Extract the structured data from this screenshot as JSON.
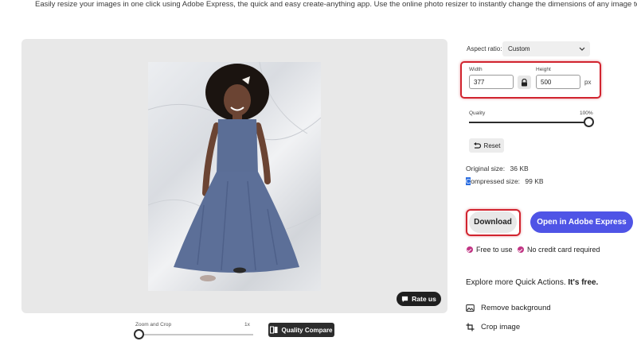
{
  "intro_text": "Easily resize your images in one click using Adobe Express, the quick and easy create-anything app. Use the online photo resizer to instantly change the dimensions of any image to share across your social",
  "preview": {
    "rate_label": "Rate us"
  },
  "controls": {
    "zoom_label": "Zoom and Crop",
    "zoom_value": "1x",
    "zoom_level": 0,
    "quality_compare_label": "Quality Compare"
  },
  "panel": {
    "aspect_label": "Aspect ratio:",
    "aspect_value": "Custom",
    "width_label": "Width",
    "width_value": "377",
    "height_label": "Height",
    "height_value": "500",
    "unit": "px",
    "quality_label": "Quality",
    "quality_value": "100%",
    "quality_level": 1.0,
    "reset_label": "Reset",
    "original_size_label": "Original size:",
    "original_size_value": "36 KB",
    "compressed_first_char": "C",
    "compressed_rest": "ompressed size:",
    "compressed_size_value": "99 KB",
    "download_label": "Download",
    "open_label": "Open in Adobe Express",
    "perk_free": "Free to use",
    "perk_card": "No credit card required",
    "explore_text": "Explore more Quick Actions.",
    "explore_bold": "It's free.",
    "quick_actions": [
      {
        "label": "Remove background",
        "icon": "image-icon"
      },
      {
        "label": "Crop image",
        "icon": "crop-icon"
      }
    ]
  },
  "colors": {
    "accent": "#4f54e6",
    "highlight_outline": "#d1242f",
    "perk_badge": "#c13584"
  }
}
